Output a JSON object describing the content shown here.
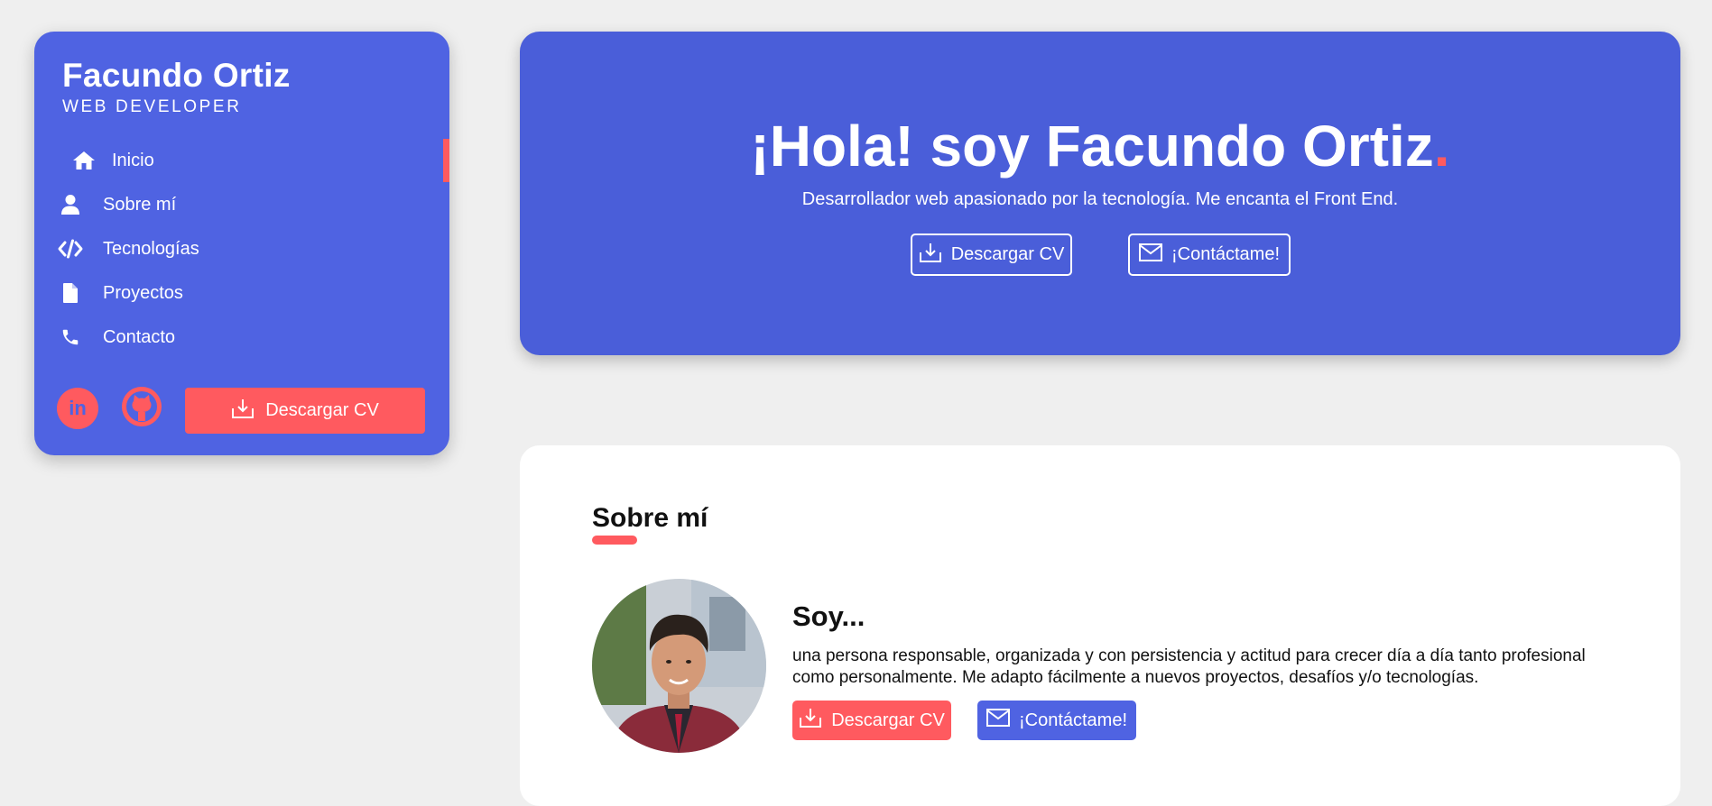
{
  "sidebar": {
    "name": "Facundo Ortiz",
    "role": "WEB DEVELOPER",
    "nav": [
      {
        "label": "Inicio",
        "icon": "home-icon",
        "active": true
      },
      {
        "label": "Sobre mí",
        "icon": "user-icon"
      },
      {
        "label": "Tecnologías",
        "icon": "code-icon"
      },
      {
        "label": "Proyectos",
        "icon": "file-icon"
      },
      {
        "label": "Contacto",
        "icon": "phone-icon"
      }
    ],
    "social": [
      {
        "label": "in",
        "icon": "linkedin-icon"
      },
      {
        "icon": "github-icon"
      }
    ],
    "download_label": "Descargar CV"
  },
  "hero": {
    "title": "¡Hola! soy Facundo Ortiz",
    "title_dot": ".",
    "subtitle": "Desarrollador web apasionado por la tecnología. Me encanta el Front End.",
    "download_label": "Descargar CV",
    "contact_label": "¡Contáctame!"
  },
  "about": {
    "title": "Sobre mí",
    "heading": "Soy...",
    "text": "una persona responsable, organizada y con persistencia y actitud para crecer día a día tanto profesional como personalmente. Me adapto fácilmente a nuevos proyectos, desafíos y/o tecnologías.",
    "download_label": "Descargar CV",
    "contact_label": "¡Contáctame!"
  },
  "colors": {
    "accent": "#ff5a5f",
    "primary": "#4f63e2",
    "hero_bg": "#4a5ed9",
    "page_bg": "#efefef"
  }
}
